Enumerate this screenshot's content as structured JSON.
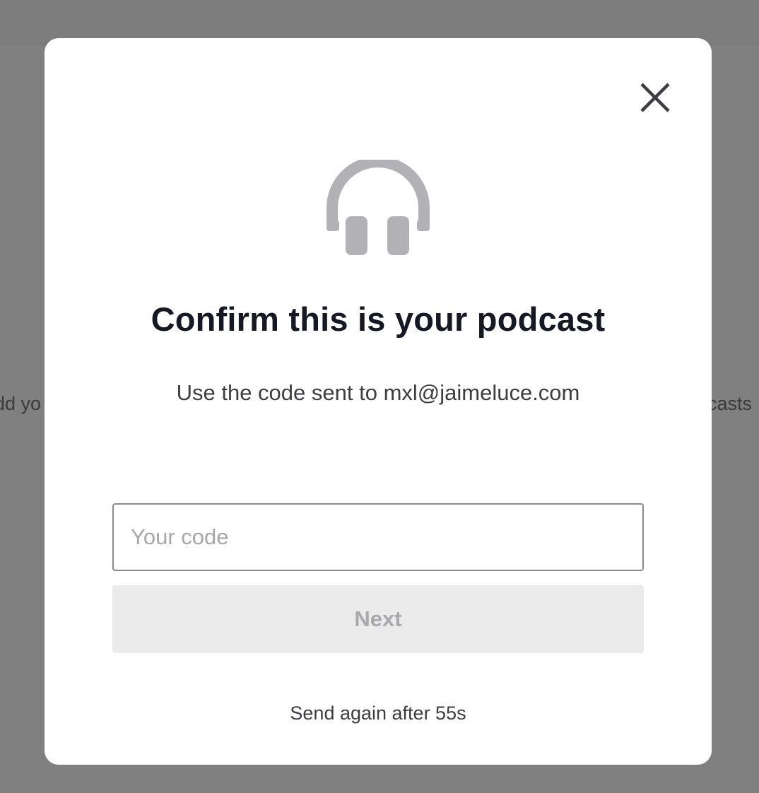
{
  "background": {
    "left_fragment": "dd yo",
    "right_fragment": "dcasts"
  },
  "modal": {
    "close_icon": "close-icon",
    "hero_icon": "headphones-icon",
    "title": "Confirm this is your podcast",
    "subtitle": "Use the code sent to mxl@jaimeluce.com",
    "code_input": {
      "value": "",
      "placeholder": "Your code"
    },
    "next_label": "Next",
    "resend_text": "Send again after 55s"
  },
  "colors": {
    "overlay": "#808080",
    "title": "#161823",
    "icon_gray": "#b2b2b6",
    "button_disabled_bg": "#ebebeb",
    "button_disabled_text": "#a8a8ad"
  }
}
